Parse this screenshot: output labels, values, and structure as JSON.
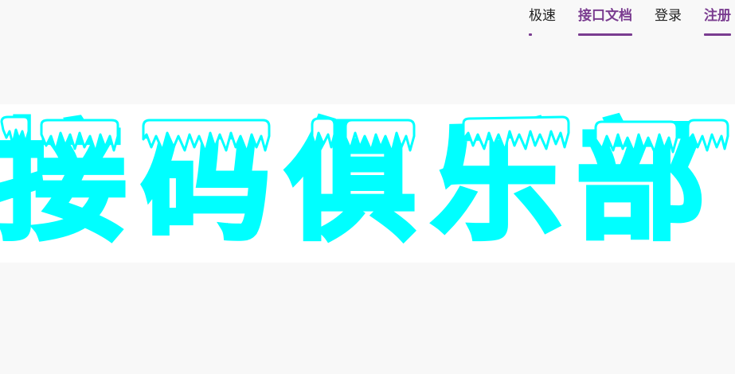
{
  "nav": {
    "items": [
      {
        "label": "极速",
        "active": false
      },
      {
        "label": "接口文档",
        "active": true
      },
      {
        "label": "登录",
        "active": false
      },
      {
        "label": "注册",
        "active": true
      }
    ]
  },
  "banner": {
    "logo_text": "接码俱乐部",
    "color": "#00ffff"
  },
  "theme": {
    "accent": "#7a3c90",
    "background": "#f8f8f8"
  }
}
